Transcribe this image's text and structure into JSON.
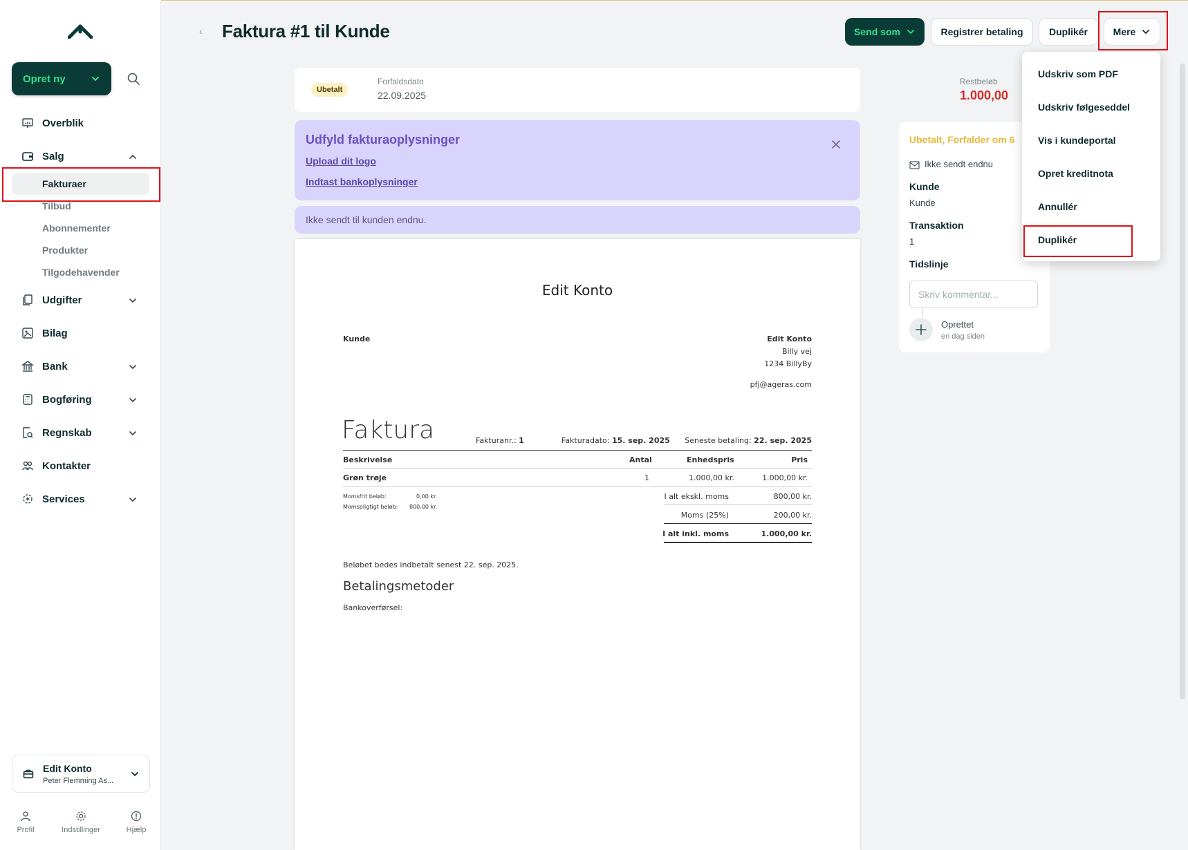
{
  "sidebar": {
    "create_label": "Opret ny",
    "nav": [
      {
        "label": "Overblik"
      },
      {
        "label": "Salg"
      },
      {
        "label": "Udgifter"
      },
      {
        "label": "Bilag"
      },
      {
        "label": "Bank"
      },
      {
        "label": "Bogføring"
      },
      {
        "label": "Regnskab"
      },
      {
        "label": "Kontakter"
      },
      {
        "label": "Services"
      }
    ],
    "salg_sub": [
      "Fakturaer",
      "Tilbud",
      "Abonnementer",
      "Produkter",
      "Tilgodehavender"
    ],
    "account": {
      "name": "Edit Konto",
      "sub": "Peter Flemming As..."
    },
    "footer": [
      "Profil",
      "Indstillinger",
      "Hjælp"
    ]
  },
  "header": {
    "title": "Faktura #1 til Kunde",
    "send_label": "Send som",
    "register_label": "Registrer betaling",
    "duplicate_label": "Duplikér",
    "more_label": "Mere"
  },
  "status": {
    "badge": "Ubetalt",
    "due_label": "Forfaldsdato",
    "due_value": "22.09.2025",
    "rest_label": "Restbeløb",
    "rest_value": "1.000,00"
  },
  "banner": {
    "title": "Udfyld fakturaoplysninger",
    "link1": "Upload dit logo",
    "link2": "Indtast bankoplysninger"
  },
  "notice": "Ikke sendt til kunden endnu.",
  "invoice": {
    "company_title": "Edit Konto",
    "customer": "Kunde",
    "sender_name": "Edit Konto",
    "sender_street": "Billy vej",
    "sender_city": "1234 BillyBy",
    "sender_email": "pfj@ageras.com",
    "heading": "Faktura",
    "number_label": "Fakturanr.:",
    "number": "1",
    "date_label": "Fakturadato:",
    "date": "15. sep. 2025",
    "latest_label": "Seneste betaling:",
    "latest": "22. sep. 2025",
    "col_desc": "Beskrivelse",
    "col_qty": "Antal",
    "col_unit": "Enhedspris",
    "col_price": "Pris",
    "line_desc": "Grøn trøje",
    "line_qty": "1",
    "line_unit": "1.000,00 kr.",
    "line_price": "1.000,00 kr.",
    "exempt_label": "Momsfrit beløb:",
    "exempt_value": "0,00 kr.",
    "taxable_label": "Momspligtigt beløb:",
    "taxable_value": "800,00 kr.",
    "sub_label": "I alt ekskl. moms",
    "sub_value": "800,00 kr.",
    "vat_label": "Moms (25%)",
    "vat_value": "200,00 kr.",
    "total_label": "I alt inkl. moms",
    "total_value": "1.000,00 kr.",
    "pay_note": "Beløbet bedes indbetalt senest 22. sep. 2025.",
    "methods_title": "Betalingsmetoder",
    "methods_item": "Bankoverførsel:"
  },
  "panel": {
    "status": "Ubetalt, Forfalder om 6",
    "sent": "Ikke sendt endnu",
    "customer_label": "Kunde",
    "customer_value": "Kunde",
    "transaction_label": "Transaktion",
    "transaction_value": "1",
    "timeline_label": "Tidslinje",
    "comment_placeholder": "Skriv kommentar...",
    "event_title": "Oprettet",
    "event_time": "en dag siden"
  },
  "menu": [
    "Udskriv som PDF",
    "Udskriv følgeseddel",
    "Vis i kundeportal",
    "Opret kreditnota",
    "Annullér",
    "Duplikér"
  ],
  "colors": {
    "brand": "#0b3b36",
    "accent": "#33e08a",
    "banner": "#d8d4fb",
    "due": "#d32e2a",
    "highlight": "#d9141b"
  }
}
